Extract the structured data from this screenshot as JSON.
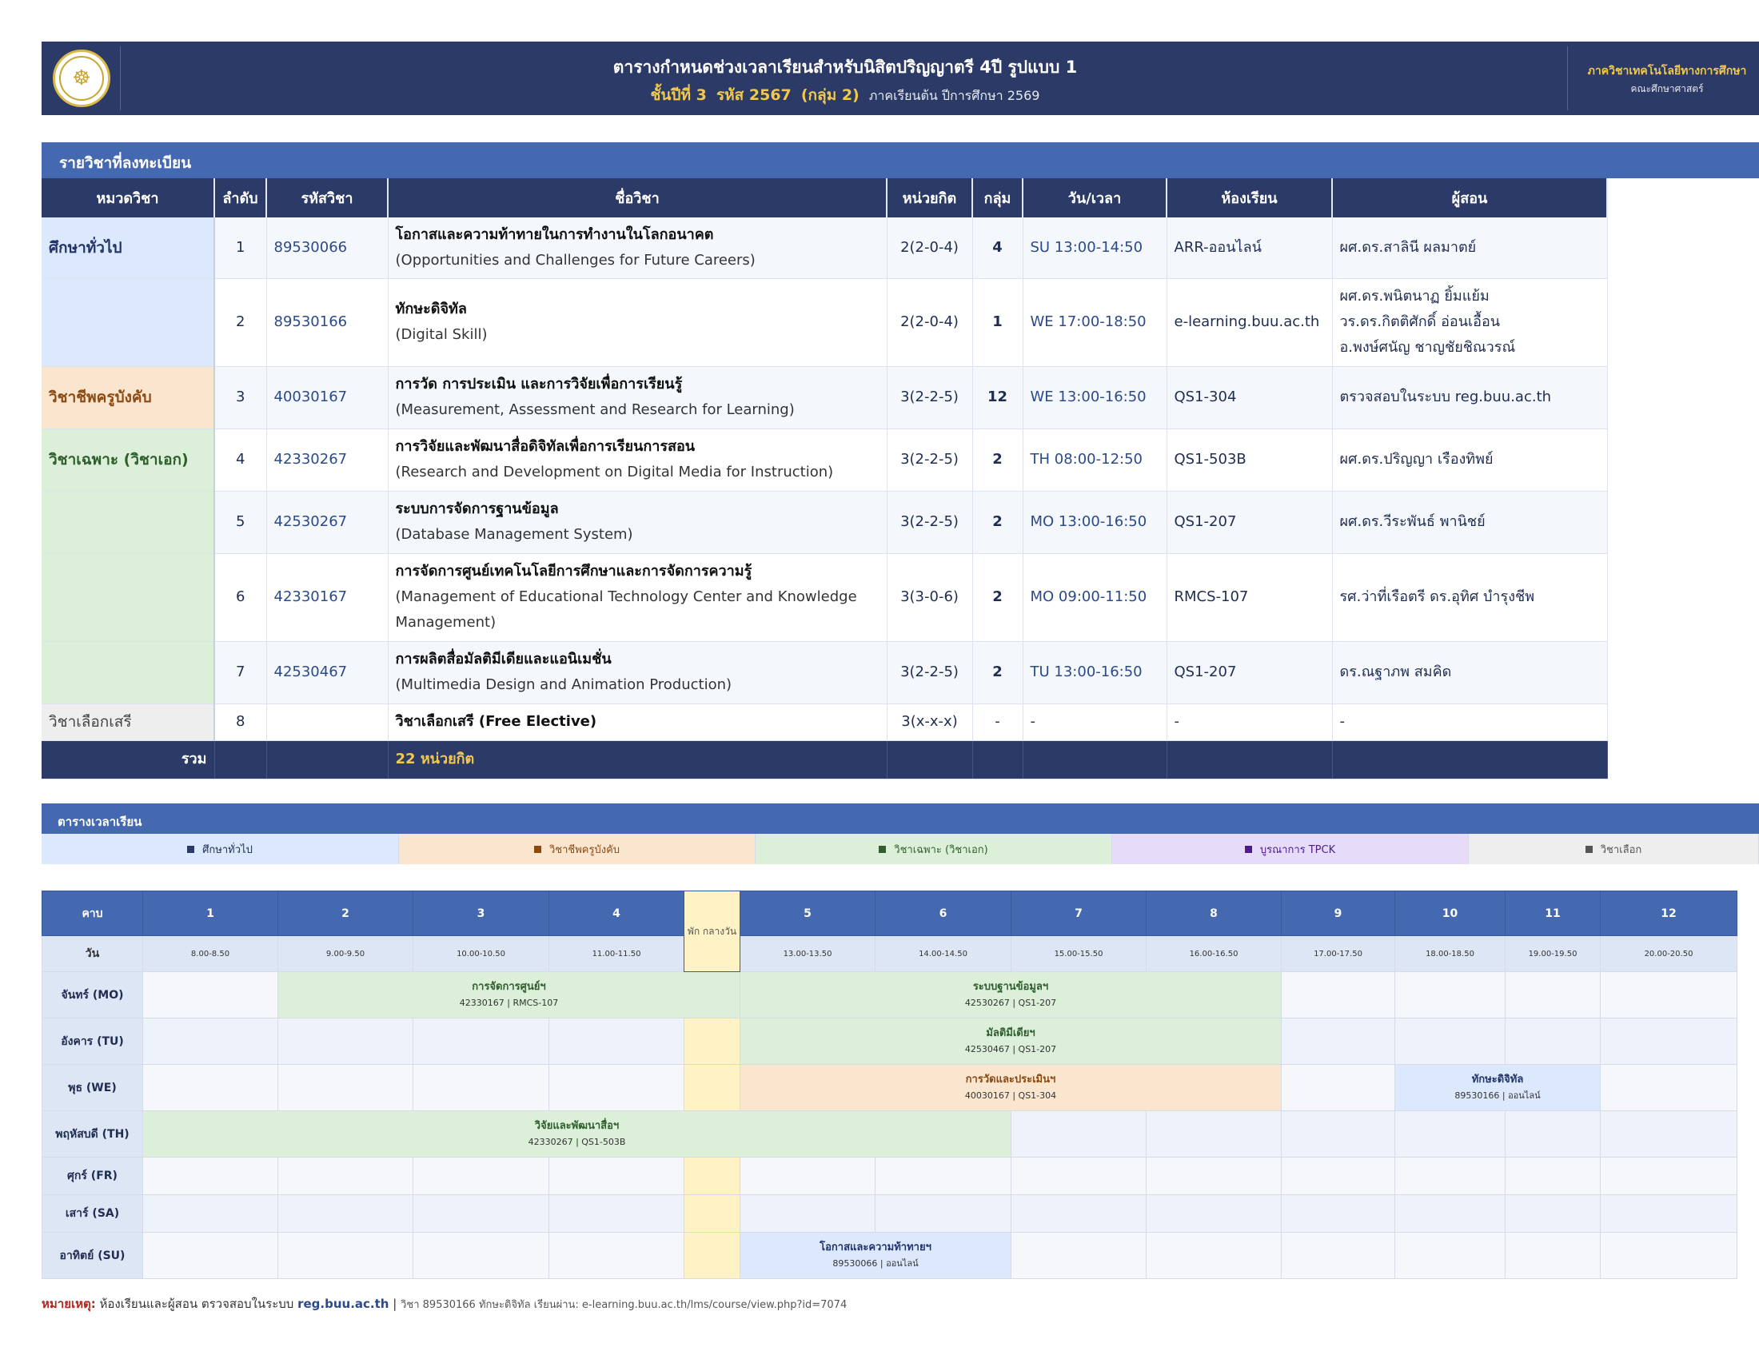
{
  "header": {
    "title": "ตารางกำหนดช่วงเวลาเรียนสำหรับนิสิตปริญญาตรี 4ปี รูปแบบ 1",
    "sub_year": "ชั้นปีที่ 3",
    "sub_code": "รหัส 2567",
    "sub_group": "(กลุ่ม 2)",
    "sub_term": "ภาคเรียนต้น ปีการศึกษา 2569",
    "department": "ภาควิชาเทคโนโลยีทางการศึกษา",
    "faculty": "คณะศึกษาศาสตร์"
  },
  "courses_section": {
    "title": "รายวิชาที่ลงทะเบียน",
    "headers": [
      "หมวดวิชา",
      "ลำดับ",
      "รหัสวิชา",
      "ชื่อวิชา",
      "หน่วยกิต",
      "กลุ่ม",
      "วัน/เวลา",
      "ห้องเรียน",
      "ผู้สอน"
    ],
    "rows": [
      {
        "category": "ศึกษาทั่วไป",
        "no": "1",
        "code": "89530066",
        "name_th": "โอกาสและความท้าทายในการทำงานในโลกอนาคต",
        "name_en": "(Opportunities and Challenges for Future Careers)",
        "credit": "2(2-0-4)",
        "group": "4",
        "time": "SU 13:00-14:50",
        "room": "ARR-ออนไลน์",
        "instructor": "ผศ.ดร.สาลินี ผลมาตย์"
      },
      {
        "category": "",
        "no": "2",
        "code": "89530166",
        "name_th": "ทักษะดิจิทัล",
        "name_en": "(Digital Skill)",
        "credit": "2(2-0-4)",
        "group": "1",
        "time": "WE 17:00-18:50",
        "room": "e-learning.buu.ac.th",
        "instructor": "ผศ.ดร.พนิตนาฏ ยิ้มแย้ม",
        "instructor2": "วร.ดร.กิตติศักดิ์ อ่อนเอื้อน",
        "instructor3": "อ.พงษ์ศนัญ ชาญชัยชิณวรณ์"
      },
      {
        "category": "วิชาชีพครูบังคับ",
        "no": "3",
        "code": "40030167",
        "name_th": "การวัด การประเมิน และการวิจัยเพื่อการเรียนรู้",
        "name_en": "(Measurement, Assessment and Research for Learning)",
        "credit": "3(2-2-5)",
        "group": "12",
        "time": "WE 13:00-16:50",
        "room": "QS1-304",
        "instructor": "ตรวจสอบในระบบ reg.buu.ac.th"
      },
      {
        "category": "วิชาเฉพาะ (วิชาเอก)",
        "no": "4",
        "code": "42330267",
        "name_th": "การวิจัยและพัฒนาสื่อดิจิทัลเพื่อการเรียนการสอน",
        "name_en": "(Research and Development on Digital Media for Instruction)",
        "credit": "3(2-2-5)",
        "group": "2",
        "time": "TH 08:00-12:50",
        "room": "QS1-503B",
        "instructor": "ผศ.ดร.ปริญญา เรืองทิพย์"
      },
      {
        "category": "",
        "no": "5",
        "code": "42530267",
        "name_th": "ระบบการจัดการฐานข้อมูล",
        "name_en": "(Database Management System)",
        "credit": "3(2-2-5)",
        "group": "2",
        "time": "MO 13:00-16:50",
        "room": "QS1-207",
        "instructor": "ผศ.ดร.วีระพันธ์ พานิชย์"
      },
      {
        "category": "",
        "no": "6",
        "code": "42330167",
        "name_th": "การจัดการศูนย์เทคโนโลยีการศึกษาและการจัดการความรู้",
        "name_en": "(Management of Educational Technology Center and Knowledge",
        "name_en2": "Management)",
        "credit": "3(3-0-6)",
        "group": "2",
        "time": "MO 09:00-11:50",
        "room": "RMCS-107",
        "instructor": "รศ.ว่าที่เรือตรี ดร.อุทิศ บำรุงชีพ"
      },
      {
        "category": "",
        "no": "7",
        "code": "42530467",
        "name_th": "การผลิตสื่อมัลติมีเดียและแอนิเมชั่น",
        "name_en": "(Multimedia Design and Animation Production)",
        "credit": "3(2-2-5)",
        "group": "2",
        "time": "TU 13:00-16:50",
        "room": "QS1-207",
        "instructor": "ดร.ณฐาภพ สมคิด"
      },
      {
        "category": "วิชาเลือกเสรี",
        "no": "8",
        "code": "",
        "name_th": "วิชาเลือกเสรี (Free Elective)",
        "credit": "3(x-x-x)",
        "group": "-",
        "time": "-",
        "room": "-",
        "instructor": "-"
      }
    ],
    "total_label": "รวม",
    "total_value": "22  หน่วยกิต"
  },
  "timetable_section": {
    "title": "ตารางเวลาเรียน",
    "legend": [
      {
        "label": "ศึกษาทั่วไป",
        "color": "#2b3a67",
        "bg": "#dce8fb"
      },
      {
        "label": "วิชาชีพครูบังคับ",
        "color": "#8a4a12",
        "bg": "#fae6cf"
      },
      {
        "label": "วิชาเฉพาะ (วิชาเอก)",
        "color": "#2f5f2f",
        "bg": "#dbefd9"
      },
      {
        "label": "บูรณาการ TPCK",
        "color": "#4b1d8a",
        "bg": "#e6dcfa"
      },
      {
        "label": "วิชาเลือก",
        "color": "#555555",
        "bg": "#eeeeee"
      }
    ],
    "period_label": "คาบ",
    "day_label": "วัน",
    "noon_label": "พัก กลางวัน",
    "periods": [
      "1",
      "2",
      "3",
      "4",
      "5",
      "6",
      "7",
      "8",
      "9",
      "10",
      "11",
      "12"
    ],
    "slots": [
      "8.00-8.50",
      "9.00-9.50",
      "10.00-10.50",
      "11.00-11.50",
      "13.00-13.50",
      "14.00-14.50",
      "15.00-15.50",
      "16.00-16.50",
      "17.00-17.50",
      "18.00-18.50",
      "19.00-19.50",
      "20.00-20.50"
    ],
    "days": [
      "จันทร์ (MO)",
      "อังคาร (TU)",
      "พุธ (WE)",
      "พฤหัสบดี (TH)",
      "ศุกร์ (FR)",
      "เสาร์ (SA)",
      "อาทิตย์ (SU)"
    ],
    "blocks": {
      "mo1": {
        "title": "การจัดการศูนย์ฯ",
        "sub": "42330167 | RMCS-107"
      },
      "mo2": {
        "title": "ระบบฐานข้อมูลฯ",
        "sub": "42530267 | QS1-207"
      },
      "tu1": {
        "title": "มัลติมีเดียฯ",
        "sub": "42530467 | QS1-207"
      },
      "we1": {
        "title": "การวัดและประเมินฯ",
        "sub": "40030167 | QS1-304"
      },
      "we2": {
        "title": "ทักษะดิจิทัล",
        "sub": "89530166 | ออนไลน์"
      },
      "th1": {
        "title": "วิจัยและพัฒนาสื่อฯ",
        "sub": "42330267 | QS1-503B"
      },
      "su1": {
        "title": "โอกาสและความท้าทายฯ",
        "sub": "89530066 | ออนไลน์"
      }
    }
  },
  "note": {
    "label": "หมายเหตุ:",
    "text": "ห้องเรียนและผู้สอน ตรวจสอบในระบบ",
    "link": "reg.buu.ac.th",
    "sep": "|",
    "extra": "วิชา 89530166 ทักษะดิจิทัล เรียนผ่าน: e-learning.buu.ac.th/lms/course/view.php?id=7074"
  }
}
